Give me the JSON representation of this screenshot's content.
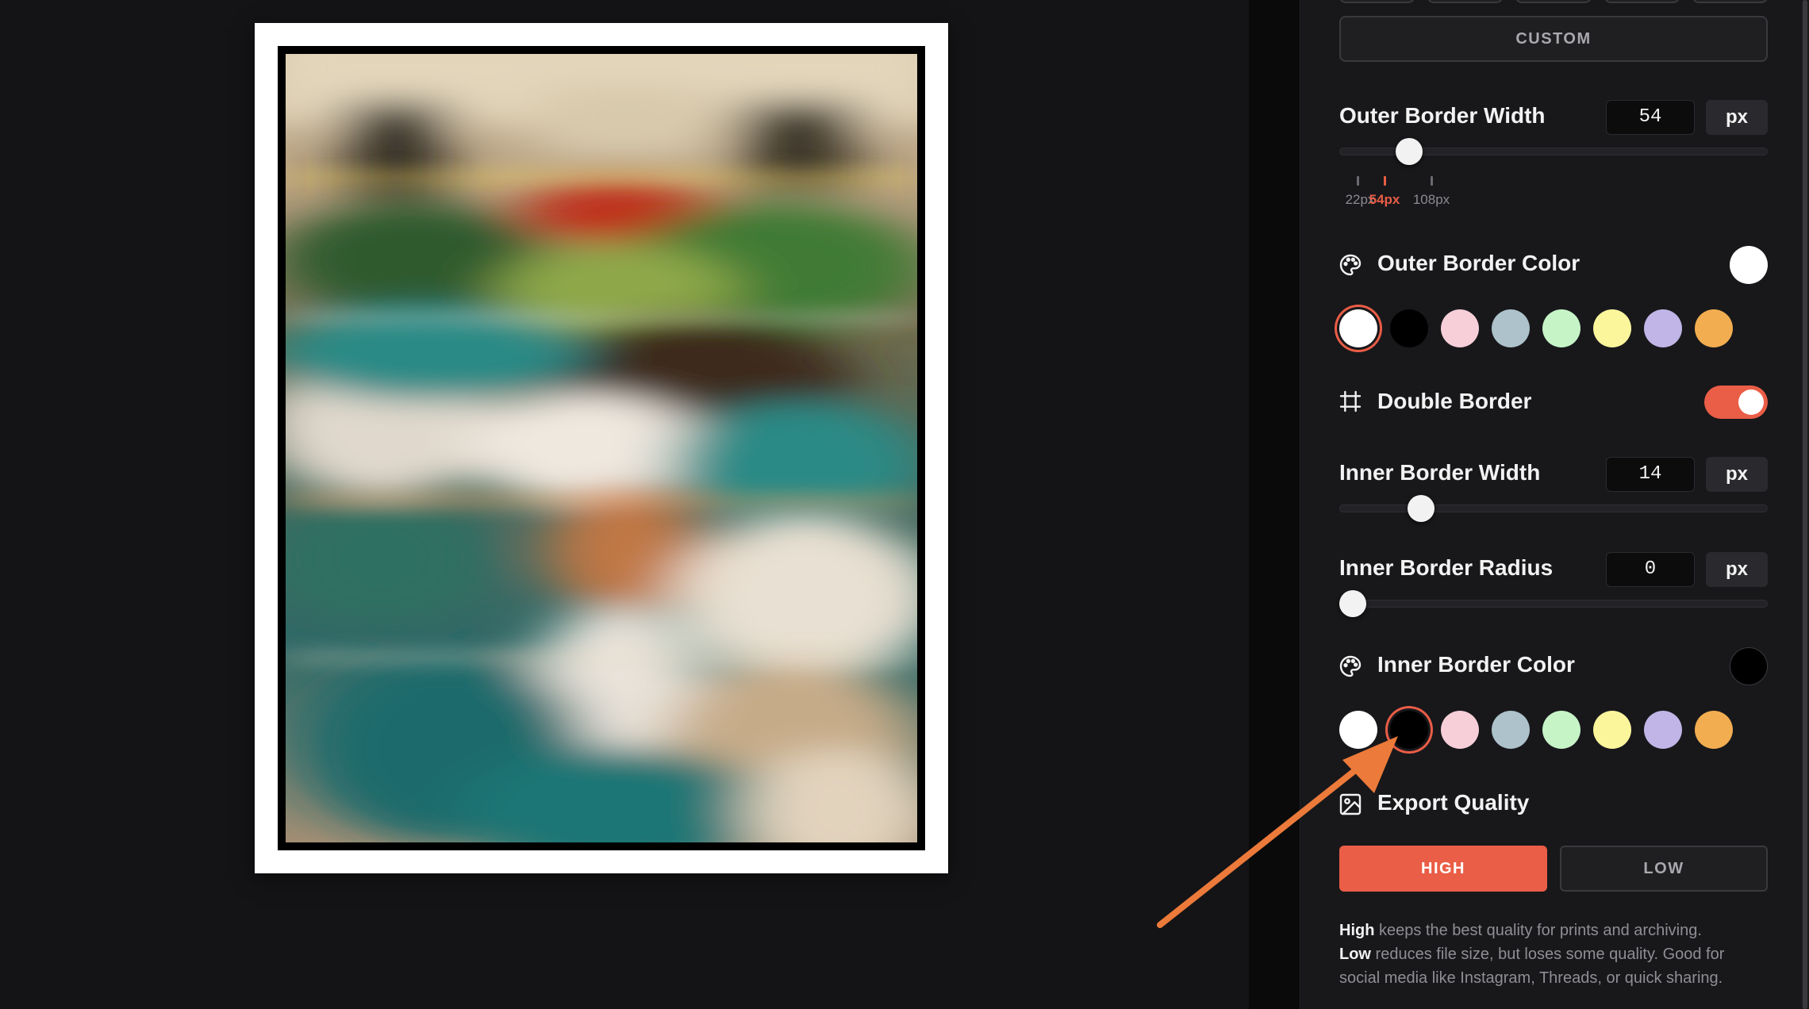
{
  "panel": {
    "preset": {
      "custom_label": "CUSTOM"
    },
    "outer_border_width": {
      "label": "Outer Border Width",
      "value": "54",
      "unit": "px",
      "slider_fraction": 0.14,
      "ticks": [
        {
          "label": "22px",
          "active": false
        },
        {
          "label": "54px",
          "active": true
        },
        {
          "label": "108px",
          "active": false
        }
      ]
    },
    "outer_border_color": {
      "label": "Outer Border Color",
      "current": "#ffffff",
      "selected_index": 0
    },
    "swatches": [
      "#ffffff",
      "#000000",
      "#f6cfd9",
      "#adc2cb",
      "#c6f4c7",
      "#fbf69b",
      "#c0b5e6",
      "#f2ad50"
    ],
    "double_border": {
      "label": "Double Border",
      "enabled": true
    },
    "inner_border_width": {
      "label": "Inner Border Width",
      "value": "14",
      "unit": "px",
      "slider_fraction": 0.17
    },
    "inner_border_radius": {
      "label": "Inner Border Radius",
      "value": "0",
      "unit": "px",
      "slider_fraction": 0.0
    },
    "inner_border_color": {
      "label": "Inner Border Color",
      "current": "#000000",
      "selected_index": 1
    },
    "export_quality": {
      "label": "Export Quality",
      "high_label": "HIGH",
      "low_label": "LOW",
      "selected": "HIGH",
      "help_high_bold": "High",
      "help_high_text": " keeps the best quality for prints and archiving.",
      "help_low_bold": "Low",
      "help_low_text": " reduces file size, but loses some quality. Good for social media like Instagram, Threads, or quick sharing."
    }
  },
  "preview": {
    "outer_color": "#ffffff",
    "inner_color": "#000000"
  },
  "colors": {
    "accent": "#ea5d46",
    "annotation_arrow": "#ec7a3a"
  },
  "icons": {
    "outer_border_color": "palette-icon",
    "double_border": "frame-grid-icon",
    "inner_border_color": "palette-icon",
    "export_quality": "image-icon"
  }
}
